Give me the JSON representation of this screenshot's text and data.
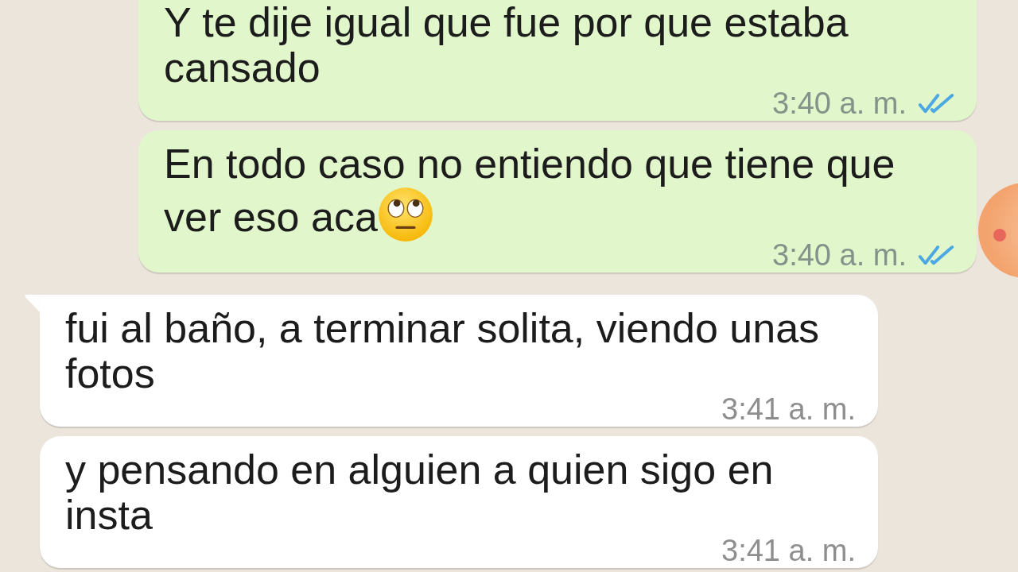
{
  "messages": [
    {
      "kind": "outgoing",
      "text": "Y te dije igual que fue por que estaba cansado",
      "time": "3:40 a. m.",
      "read": true
    },
    {
      "kind": "outgoing",
      "text": "En todo caso no entiendo que tiene que ver eso aca",
      "emoji": true,
      "time": "3:40 a. m.",
      "read": true
    },
    {
      "kind": "incoming",
      "text": "fui al baño, a terminar solita, viendo unas fotos",
      "time": "3:41 a. m."
    },
    {
      "kind": "incoming",
      "text": "y pensando en alguien a quien sigo en insta",
      "time": "3:41 a. m."
    }
  ]
}
